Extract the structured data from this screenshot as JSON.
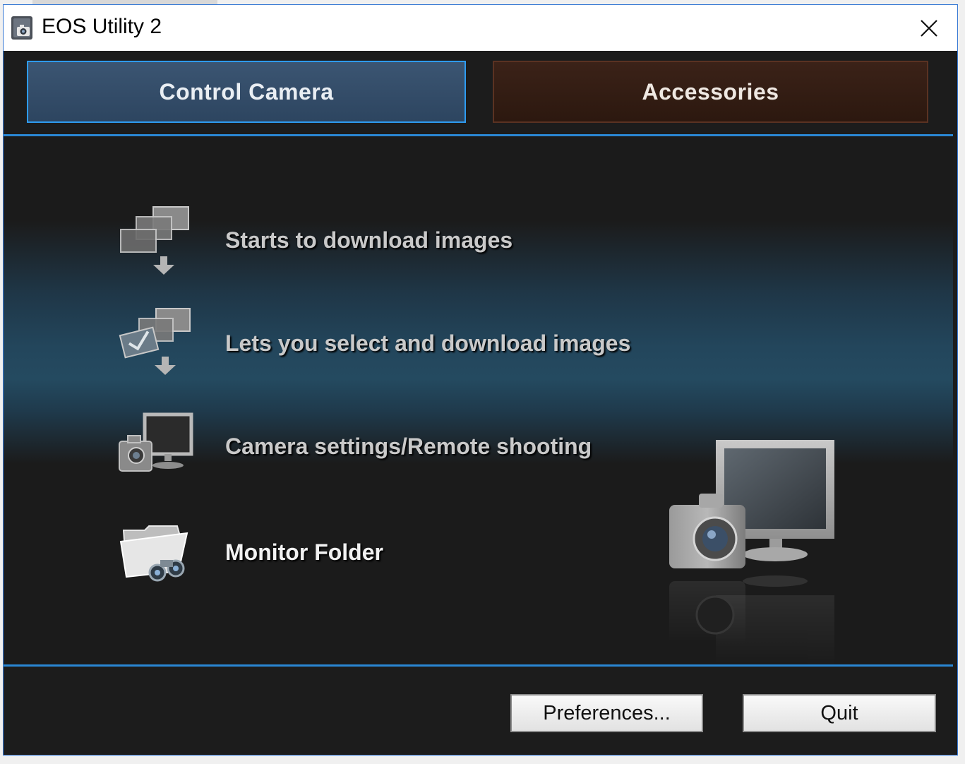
{
  "window": {
    "title": "EOS Utility 2",
    "close_glyph": "✕"
  },
  "tabs": {
    "control_camera": "Control Camera",
    "accessories": "Accessories"
  },
  "menu": {
    "items": [
      {
        "label": "Starts to download images",
        "icon": "download-images-icon"
      },
      {
        "label": "Lets you select and download images",
        "icon": "select-download-icon"
      },
      {
        "label": "Camera settings/Remote shooting",
        "icon": "camera-monitor-icon"
      },
      {
        "label": "Monitor Folder",
        "icon": "monitor-folder-icon"
      }
    ]
  },
  "footer": {
    "preferences_label": "Preferences...",
    "quit_label": "Quit"
  },
  "colors": {
    "accent_blue": "#2a87d4",
    "tab_control_bg": "#34506c",
    "tab_accessories_bg": "#33200f",
    "background": "#1c1c1c"
  }
}
